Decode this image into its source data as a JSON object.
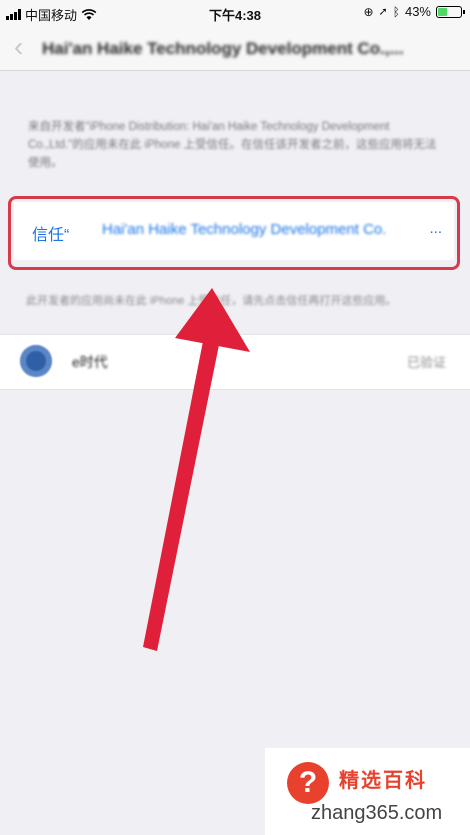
{
  "status_bar": {
    "carrier": "中国移动",
    "time": "下午4:38",
    "battery_pct": "43%",
    "battery_level": 0.43
  },
  "nav": {
    "back_icon": "chevron-left-icon",
    "title": "Hai'an Haike Technology Development Co.,..."
  },
  "description": "来自开发者\"iPhone Distribution: Hai'an Haike Technology Development Co.,Ltd.\"的应用未在此 iPhone 上受信任。在信任该开发者之前，这些应用将无法使用。",
  "trust": {
    "prefix": "信任“",
    "name": "Hai'an Haike Technology Development Co.",
    "suffix": "..."
  },
  "footnote": "此开发者的应用尚未在此 iPhone 上受信任，请先点击信任再打开这些应用。",
  "apps": [
    {
      "name": "e时代",
      "status": "已验证",
      "icon": "app-icon"
    }
  ],
  "watermark": {
    "logo": "?",
    "title": "精选百科",
    "site": "zhang365.com"
  },
  "colors": {
    "accent_blue": "#1a74e8",
    "highlight_red": "#d73a4a",
    "arrow_red": "#e0203a"
  }
}
